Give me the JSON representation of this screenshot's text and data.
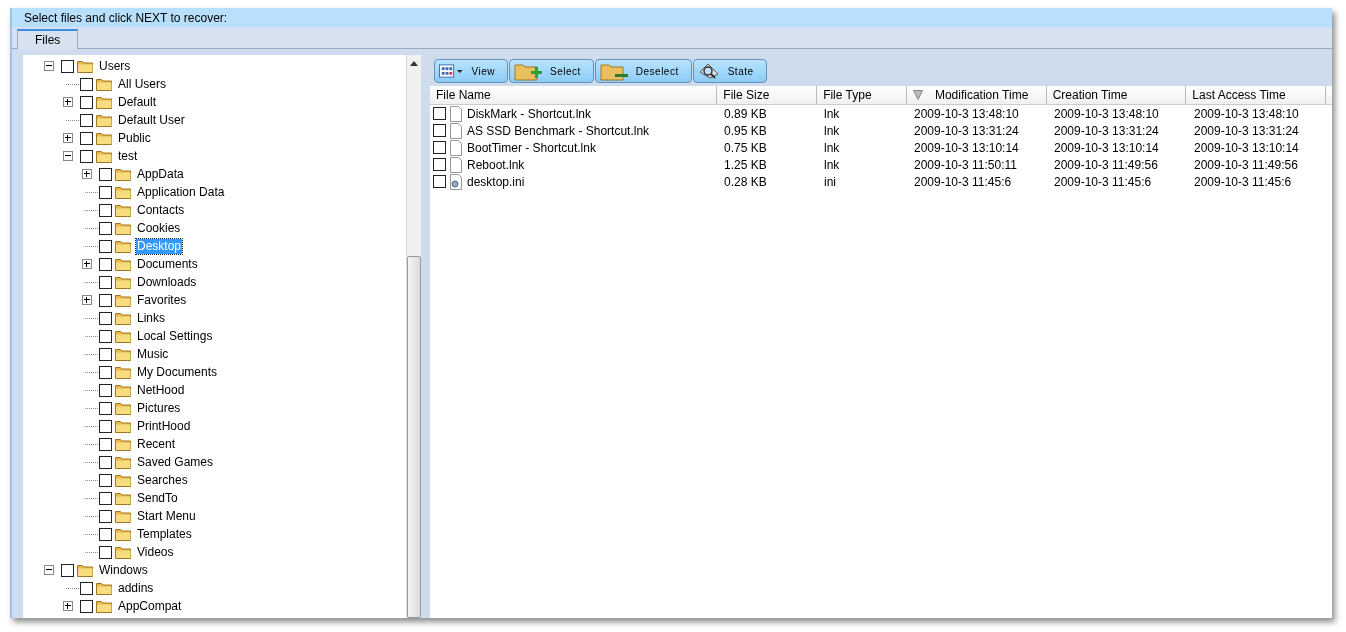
{
  "header": {
    "instruction": "Select files and click NEXT to recover:"
  },
  "tabs": [
    {
      "label": "Files",
      "selected": true
    }
  ],
  "tree": {
    "items": [
      {
        "label": "Users",
        "checked": false,
        "selected": false,
        "expanded": true,
        "children": [
          {
            "label": "All Users",
            "checked": false,
            "selected": false
          },
          {
            "label": "Default",
            "checked": false,
            "selected": false,
            "expanded": false
          },
          {
            "label": "Default User",
            "checked": false,
            "selected": false
          },
          {
            "label": "Public",
            "checked": false,
            "selected": false,
            "expanded": false
          },
          {
            "label": "test",
            "checked": false,
            "selected": false,
            "expanded": true,
            "children": [
              {
                "label": "AppData",
                "checked": false,
                "selected": false,
                "expanded": false
              },
              {
                "label": "Application Data",
                "checked": false,
                "selected": false
              },
              {
                "label": "Contacts",
                "checked": false,
                "selected": false
              },
              {
                "label": "Cookies",
                "checked": false,
                "selected": false
              },
              {
                "label": "Desktop",
                "checked": false,
                "selected": true
              },
              {
                "label": "Documents",
                "checked": false,
                "selected": false,
                "expanded": false
              },
              {
                "label": "Downloads",
                "checked": false,
                "selected": false
              },
              {
                "label": "Favorites",
                "checked": false,
                "selected": false,
                "expanded": false
              },
              {
                "label": "Links",
                "checked": false,
                "selected": false
              },
              {
                "label": "Local Settings",
                "checked": false,
                "selected": false
              },
              {
                "label": "Music",
                "checked": false,
                "selected": false
              },
              {
                "label": "My Documents",
                "checked": false,
                "selected": false
              },
              {
                "label": "NetHood",
                "checked": false,
                "selected": false
              },
              {
                "label": "Pictures",
                "checked": false,
                "selected": false
              },
              {
                "label": "PrintHood",
                "checked": false,
                "selected": false
              },
              {
                "label": "Recent",
                "checked": false,
                "selected": false
              },
              {
                "label": "Saved Games",
                "checked": false,
                "selected": false
              },
              {
                "label": "Searches",
                "checked": false,
                "selected": false
              },
              {
                "label": "SendTo",
                "checked": false,
                "selected": false
              },
              {
                "label": "Start Menu",
                "checked": false,
                "selected": false
              },
              {
                "label": "Templates",
                "checked": false,
                "selected": false
              },
              {
                "label": "Videos",
                "checked": false,
                "selected": false
              }
            ]
          }
        ]
      },
      {
        "label": "Windows",
        "checked": false,
        "selected": false,
        "expanded": true,
        "children": [
          {
            "label": "addins",
            "checked": false,
            "selected": false
          },
          {
            "label": "AppCompat",
            "checked": false,
            "selected": false,
            "expanded": false
          }
        ]
      }
    ]
  },
  "toolbar": [
    {
      "label": "View",
      "kind": "view"
    },
    {
      "label": "Select",
      "kind": "select"
    },
    {
      "label": "Deselect",
      "kind": "deselect"
    },
    {
      "label": "State",
      "kind": "state"
    }
  ],
  "table": {
    "columns": [
      {
        "label": "File Name",
        "sorted": false
      },
      {
        "label": "File Size",
        "sorted": false
      },
      {
        "label": "File Type",
        "sorted": false
      },
      {
        "label": "Modification Time",
        "sorted": true
      },
      {
        "label": "Creation Time",
        "sorted": false
      },
      {
        "label": "Last Access Time",
        "sorted": false
      }
    ],
    "rows": [
      {
        "checked": false,
        "kind": "shortcut",
        "cells": [
          "DiskMark - Shortcut.lnk",
          "0.89 KB",
          "lnk",
          "2009-10-3 13:48:10",
          "2009-10-3 13:48:10",
          "2009-10-3 13:48:10"
        ]
      },
      {
        "checked": false,
        "kind": "shortcut",
        "cells": [
          "AS SSD Benchmark - Shortcut.lnk",
          "0.95 KB",
          "lnk",
          "2009-10-3 13:31:24",
          "2009-10-3 13:31:24",
          "2009-10-3 13:31:24"
        ]
      },
      {
        "checked": false,
        "kind": "shortcut",
        "cells": [
          "BootTimer - Shortcut.lnk",
          "0.75 KB",
          "lnk",
          "2009-10-3 13:10:14",
          "2009-10-3 13:10:14",
          "2009-10-3 13:10:14"
        ]
      },
      {
        "checked": false,
        "kind": "shortcut",
        "cells": [
          "Reboot.lnk",
          "1.25 KB",
          "lnk",
          "2009-10-3 11:50:11",
          "2009-10-3 11:49:56",
          "2009-10-3 11:49:56"
        ]
      },
      {
        "checked": false,
        "kind": "settings",
        "cells": [
          "desktop.ini",
          "0.28 KB",
          "ini",
          "2009-10-3 11:45:6",
          "2009-10-3 11:45:6",
          "2009-10-3 11:45:6"
        ]
      }
    ]
  }
}
